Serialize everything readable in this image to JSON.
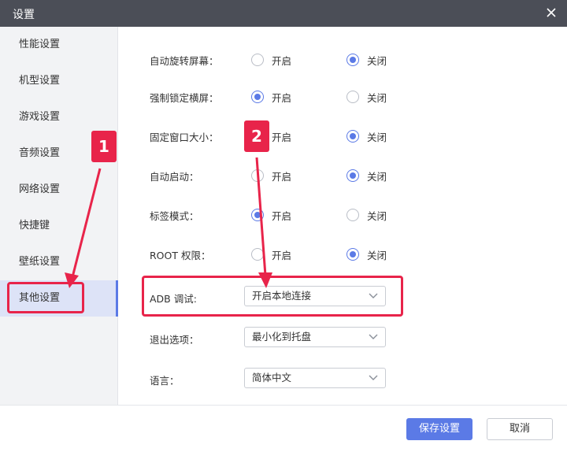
{
  "window": {
    "title": "设置"
  },
  "sidebar": {
    "items": [
      {
        "label": "性能设置"
      },
      {
        "label": "机型设置"
      },
      {
        "label": "游戏设置"
      },
      {
        "label": "音频设置"
      },
      {
        "label": "网络设置"
      },
      {
        "label": "快捷键"
      },
      {
        "label": "壁纸设置"
      },
      {
        "label": "其他设置",
        "active": true
      }
    ]
  },
  "settings": {
    "radio_rows": [
      {
        "label": "自动旋转屏幕：",
        "on_label": "开启",
        "off_label": "关闭",
        "selected": "off"
      },
      {
        "label": "强制锁定横屏：",
        "on_label": "开启",
        "off_label": "关闭",
        "selected": "on"
      },
      {
        "label": "固定窗口大小：",
        "on_label": "开启",
        "off_label": "关闭",
        "selected": "off"
      },
      {
        "label": "自动启动：",
        "on_label": "开启",
        "off_label": "关闭",
        "selected": "off"
      },
      {
        "label": "标签模式：",
        "on_label": "开启",
        "off_label": "关闭",
        "selected": "on"
      },
      {
        "label": "ROOT 权限：",
        "on_label": "开启",
        "off_label": "关闭",
        "selected": "off"
      }
    ],
    "select_rows": [
      {
        "label": "ADB 调试:",
        "value": "开启本地连接"
      },
      {
        "label": "退出选项：",
        "value": "最小化到托盘"
      },
      {
        "label": "语言：",
        "value": "简体中文"
      }
    ]
  },
  "footer": {
    "save_label": "保存设置",
    "cancel_label": "取消"
  },
  "annotations": {
    "badge1": "1",
    "badge2": "2",
    "color": "#e8244a"
  },
  "colors": {
    "accent": "#5b7ae6",
    "titlebar": "#4b4e57",
    "sidebar_bg": "#f2f3f5",
    "active_bg": "#dde3f7"
  }
}
